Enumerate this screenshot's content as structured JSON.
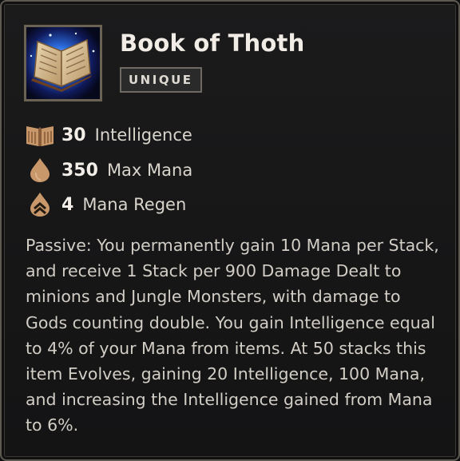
{
  "item": {
    "name": "Book of Thoth",
    "rarity": "UNIQUE",
    "icon": "open-spellbook-icon"
  },
  "stats": [
    {
      "value": "30",
      "label": "Intelligence",
      "icon": "intelligence-book-icon"
    },
    {
      "value": "350",
      "label": "Max Mana",
      "icon": "mana-drop-icon"
    },
    {
      "value": "4",
      "label": "Mana Regen",
      "icon": "mana-regen-icon"
    }
  ],
  "description": "Passive: You permanently gain 10 Mana per Stack, and receive 1 Stack per 900 Damage Dealt to minions and Jungle Monsters, with damage to Gods counting double. You gain Intelligence equal to 4% of your Mana from items. At 50 stacks this item Evolves, gaining 20 Intelligence, 100 Mana, and increasing the Intelligence gained from Mana to 6%.",
  "colors": {
    "stat_icon": "#c8976a",
    "title": "#f1ede6",
    "body_text": "#d2cec6",
    "border": "#5e5a51"
  }
}
